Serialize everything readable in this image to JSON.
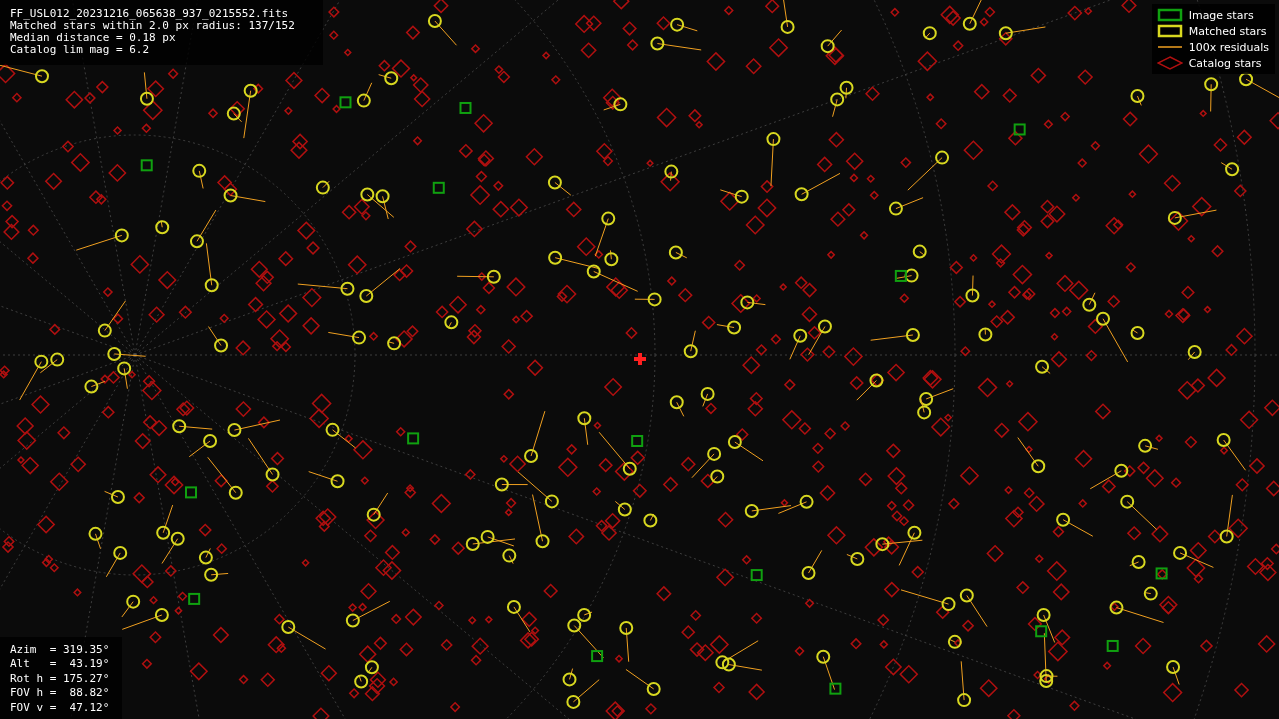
{
  "info_lines": [
    "FF_USL012_20231216_065638_937_0215552.fits",
    "Matched stars within 2.0 px radius: 137/152",
    "Median distance = 0.18 px",
    "Catalog lim mag = 6.2"
  ],
  "legend": [
    {
      "kind": "image",
      "label": "Image stars"
    },
    {
      "kind": "matched",
      "label": "Matched stars"
    },
    {
      "kind": "residual",
      "label": "100x residuals"
    },
    {
      "kind": "catalog",
      "label": "Catalog stars"
    }
  ],
  "pointing_lines": [
    "Azim  = 319.35°",
    "Alt   =  43.19°",
    "Rot h = 175.27°",
    "FOV h =  88.82°",
    "FOV v =  47.12°"
  ]
}
